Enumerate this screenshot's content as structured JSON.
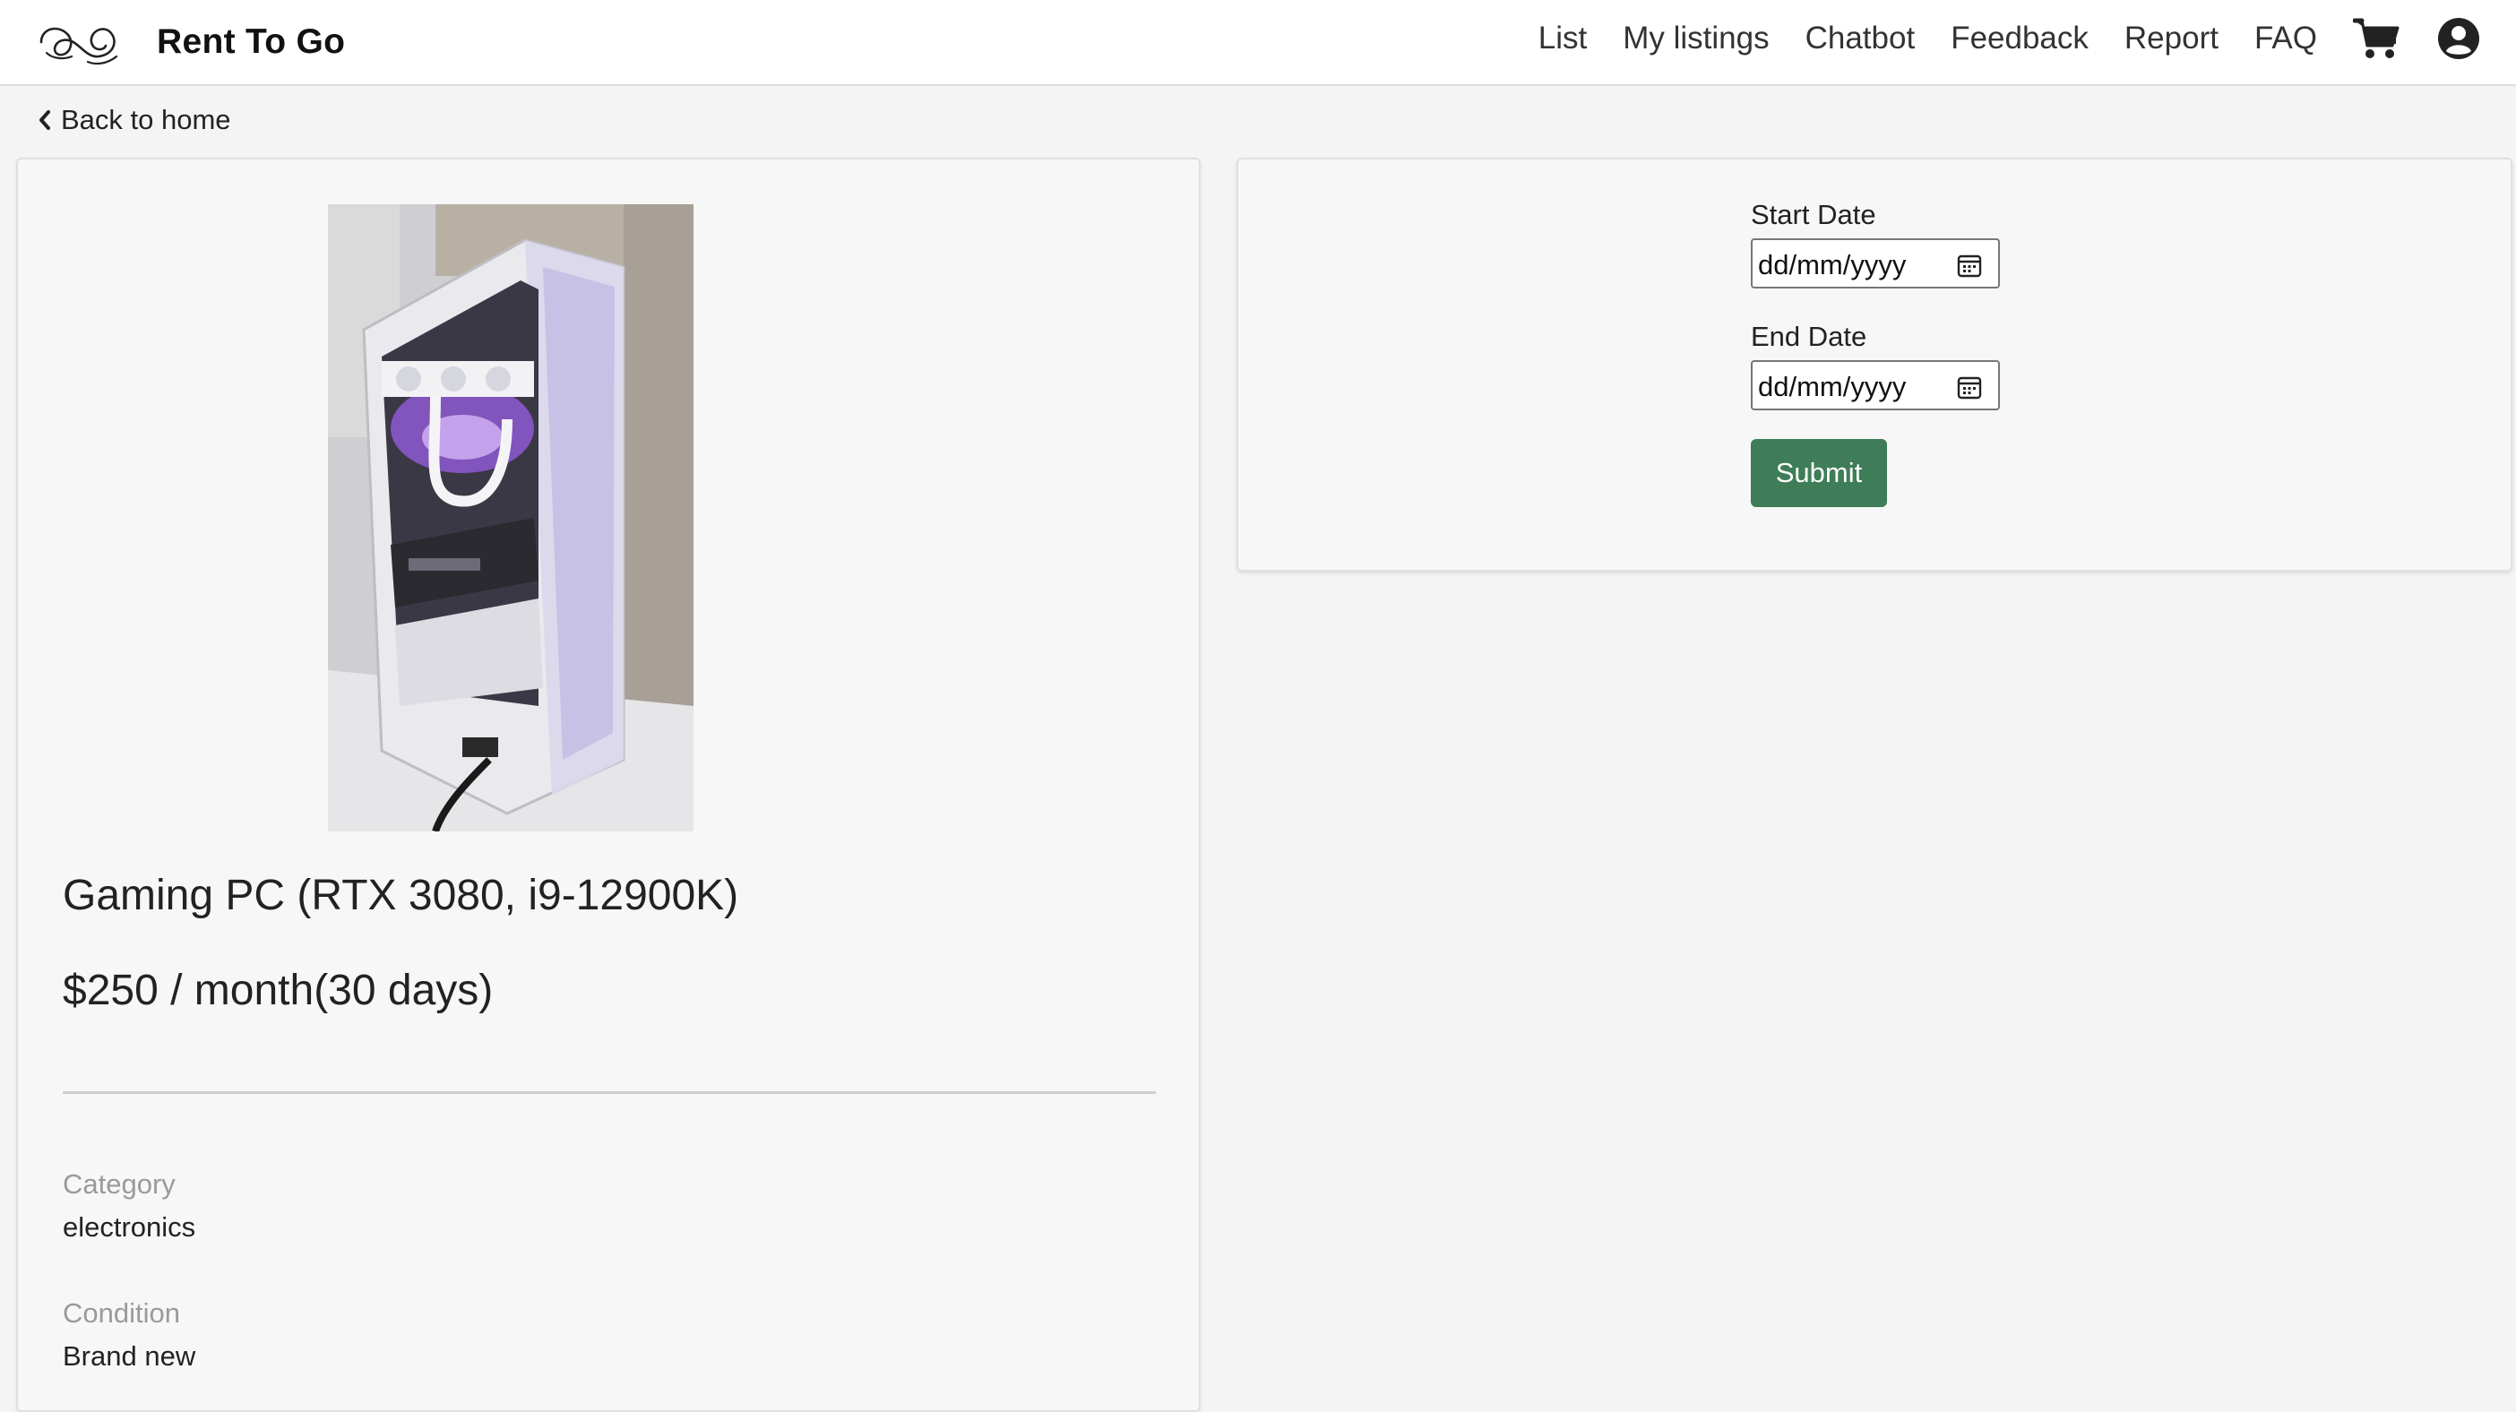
{
  "app": {
    "brand_name": "Rent To Go"
  },
  "nav": {
    "links": [
      "List",
      "My listings",
      "Chatbot",
      "Feedback",
      "Report",
      "FAQ"
    ],
    "cart_icon": "shopping-cart-icon",
    "account_icon": "user-circle-icon"
  },
  "back_link": {
    "label": "Back to home"
  },
  "product": {
    "title": "Gaming PC (RTX 3080, i9-12900K)",
    "price": "$250 / month(30 days)",
    "details": [
      {
        "label": "Category",
        "value": "electronics"
      },
      {
        "label": "Condition",
        "value": "Brand new"
      }
    ]
  },
  "booking_form": {
    "start_date_label": "Start Date",
    "start_date_placeholder": "dd/mm/yyyy",
    "end_date_label": "End Date",
    "end_date_placeholder": "dd/mm/yyyy",
    "submit_label": "Submit"
  },
  "colors": {
    "submit_button": "#3e7d57",
    "page_background": "#f4f4f4",
    "card_background": "#f7f7f7"
  }
}
